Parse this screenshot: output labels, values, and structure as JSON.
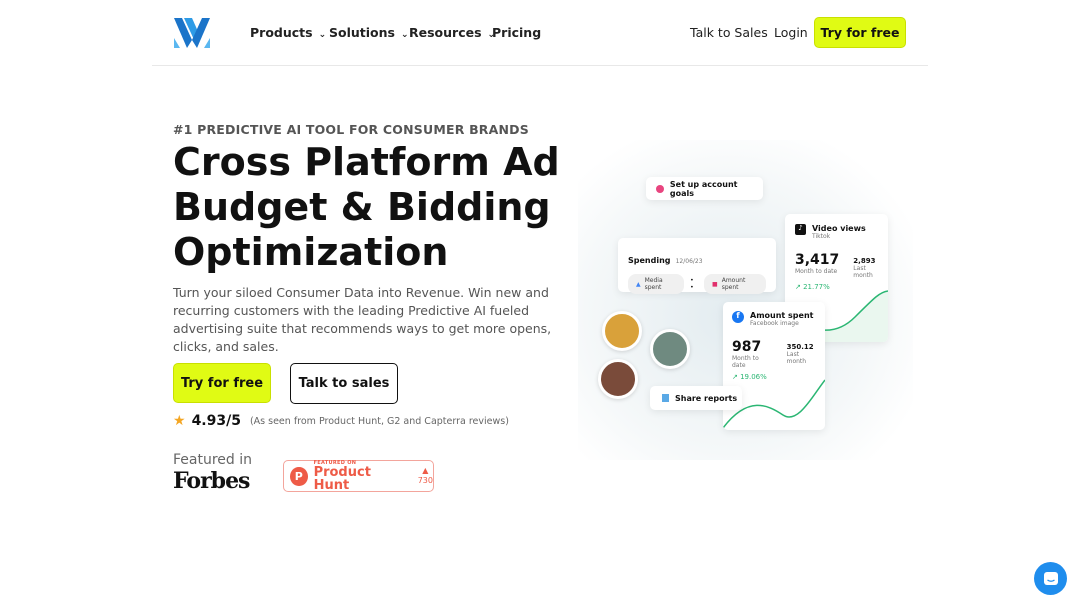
{
  "nav": {
    "items": [
      {
        "label": "Products",
        "chevron": true
      },
      {
        "label": "Solutions",
        "chevron": true
      },
      {
        "label": "Resources",
        "chevron": true
      },
      {
        "label": "Pricing",
        "chevron": false
      }
    ],
    "talk_to_sales": "Talk to Sales",
    "login": "Login",
    "try_free": "Try for free"
  },
  "hero": {
    "eyebrow": "#1 PREDICTIVE AI TOOL FOR CONSUMER BRANDS",
    "title": "Cross Platform Ad Budget & Bidding Optimization",
    "subtitle": "Turn your siloed Consumer Data into Revenue. Win new and recurring customers with the leading Predictive AI fueled advertising suite that recommends ways to get more opens, clicks, and sales.",
    "cta_primary": "Try for free",
    "cta_secondary": "Talk to sales",
    "rating": "4.93/5",
    "rating_note": "(As seen from Product Hunt, G2 and Capterra reviews)",
    "featured_in": "Featured in",
    "forbes": "Forbes",
    "producthunt": {
      "small": "FEATURED ON",
      "name": "Product Hunt",
      "votes": "730"
    }
  },
  "illustration": {
    "goals": "Set up account goals",
    "spending": {
      "title": "Spending",
      "date": "12/06/23",
      "pill1": "Media spent",
      "pill2": "Amount spent"
    },
    "video": {
      "title": "Video views",
      "platform": "Tiktok",
      "value": "3,417",
      "value_label": "Month to date",
      "last": "2,893",
      "last_label": "Last month",
      "growth": "21.77%"
    },
    "amount": {
      "title": "Amount spent",
      "platform": "Facebook image",
      "value": "987",
      "value_label": "Month to date",
      "last": "350.12",
      "last_label": "Last month",
      "growth": "19.06%"
    },
    "share": "Share reports"
  },
  "colors": {
    "accent": "#e0fb14",
    "chat": "#1f8ded",
    "producthunt": "#ee5b47",
    "growth": "#2bb673"
  }
}
